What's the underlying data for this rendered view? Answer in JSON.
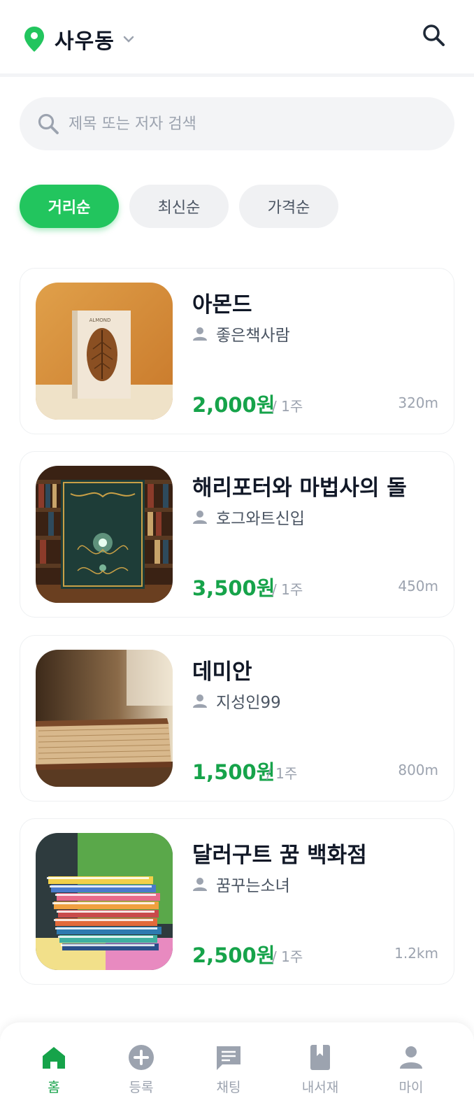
{
  "header": {
    "location": "사우동",
    "icons": [
      "location-pin-icon",
      "chevron-down-icon",
      "search-icon"
    ]
  },
  "search": {
    "placeholder": "제목 또는 저자 검색"
  },
  "sort_chips": [
    {
      "label": "거리순",
      "active": true
    },
    {
      "label": "최신순",
      "active": false
    },
    {
      "label": "가격순",
      "active": false
    }
  ],
  "books": [
    {
      "title": "아몬드",
      "owner": "좋은책사람",
      "price": "2,000원",
      "period": "/ 1주",
      "distance": "320m"
    },
    {
      "title": "해리포터와 마법사의 돌",
      "owner": "호그와트신입",
      "price": "3,500원",
      "period": "/ 1주",
      "distance": "450m"
    },
    {
      "title": "데미안",
      "owner": "지성인99",
      "price": "1,500원",
      "period": "/ 1주",
      "distance": "800m"
    },
    {
      "title": "달러구트 꿈 백화점",
      "owner": "꿈꾸는소녀",
      "price": "2,500원",
      "period": "/ 1주",
      "distance": "1.2km"
    }
  ],
  "thumb_text": {
    "almond_cover": "ALMOND"
  },
  "nav": [
    {
      "label": "홈",
      "icon": "home-icon",
      "active": true
    },
    {
      "label": "등록",
      "icon": "add-circle-icon",
      "active": false
    },
    {
      "label": "채팅",
      "icon": "chat-icon",
      "active": false
    },
    {
      "label": "내서재",
      "icon": "bookmark-book-icon",
      "active": false
    },
    {
      "label": "마이",
      "icon": "user-icon",
      "active": false
    }
  ],
  "colors": {
    "accent": "#22c55e",
    "price": "#16a34a",
    "muted": "#9ca3af"
  }
}
